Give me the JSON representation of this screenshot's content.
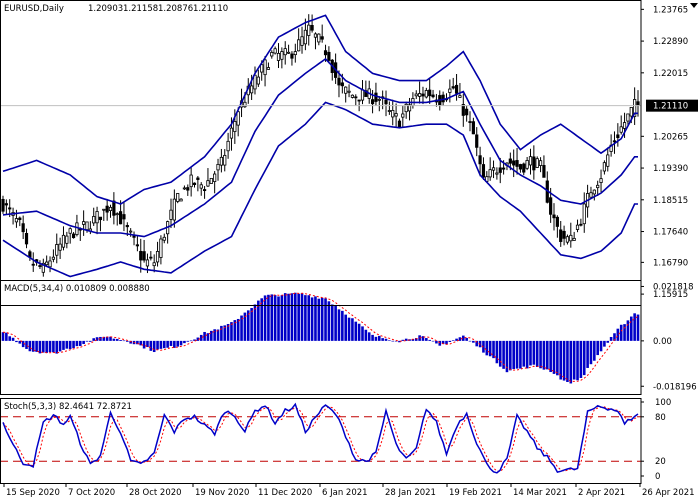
{
  "chart_data": {
    "type": "candlestick",
    "symbol_header": "EURUSD,Daily",
    "ohlc_header": [
      "1.20903",
      "1.21158",
      "1.20876",
      "1.21110"
    ],
    "current_price_label": "1.21110",
    "current_price": 1.2111,
    "colors": {
      "band": "#0000a8",
      "candle": "#000000",
      "macd_hist": "#0000c8",
      "macd_signal": "#ff0000",
      "stoch_main": "#0000c8",
      "stoch_signal": "#ff0000",
      "level_line": "#c00000",
      "current_line": "#c0c0c0",
      "price_box": "#000000",
      "price_box_text": "#ffffff"
    },
    "price_axis": {
      "ticks": [
        "1.23765",
        "1.22890",
        "1.22015",
        "1.21110",
        "1.20265",
        "1.19390",
        "1.18515",
        "1.17640",
        "1.16790",
        "1.15915"
      ],
      "min": 1.1567,
      "max": 1.2394
    },
    "x_axis": {
      "ticks": [
        "15 Sep 2020",
        "7 Oct 2020",
        "28 Oct 2020",
        "19 Nov 2020",
        "11 Dec 2020",
        "6 Jan 2021",
        "28 Jan 2021",
        "19 Feb 2021",
        "14 Mar 2021",
        "2 Apr 2021",
        "26 Apr 2021"
      ],
      "bar_count": 160
    },
    "price_anchors": [
      [
        0,
        1.184
      ],
      [
        5,
        1.178
      ],
      [
        8,
        1.168
      ],
      [
        12,
        1.166
      ],
      [
        15,
        1.17
      ],
      [
        20,
        1.176
      ],
      [
        25,
        1.178
      ],
      [
        30,
        1.182
      ],
      [
        32,
        1.184
      ],
      [
        35,
        1.18
      ],
      [
        38,
        1.175
      ],
      [
        42,
        1.168
      ],
      [
        45,
        1.168
      ],
      [
        48,
        1.176
      ],
      [
        52,
        1.186
      ],
      [
        56,
        1.19
      ],
      [
        60,
        1.189
      ],
      [
        65,
        1.195
      ],
      [
        70,
        1.21
      ],
      [
        75,
        1.218
      ],
      [
        80,
        1.225
      ],
      [
        85,
        1.225
      ],
      [
        88,
        1.228
      ],
      [
        91,
        1.232
      ],
      [
        94,
        1.229
      ],
      [
        97,
        1.225
      ],
      [
        100,
        1.216
      ],
      [
        104,
        1.214
      ],
      [
        108,
        1.214
      ],
      [
        112,
        1.213
      ],
      [
        115,
        1.209
      ],
      [
        118,
        1.207
      ],
      [
        122,
        1.213
      ],
      [
        126,
        1.215
      ],
      [
        130,
        1.213
      ],
      [
        134,
        1.216
      ],
      [
        137,
        1.21
      ],
      [
        140,
        1.203
      ],
      [
        143,
        1.19
      ],
      [
        146,
        1.193
      ],
      [
        150,
        1.196
      ],
      [
        154,
        1.194
      ],
      [
        157,
        1.196
      ],
      [
        160,
        1.194
      ],
      [
        163,
        1.182
      ],
      [
        166,
        1.175
      ],
      [
        169,
        1.174
      ],
      [
        172,
        1.18
      ],
      [
        175,
        1.188
      ],
      [
        178,
        1.192
      ],
      [
        181,
        1.2
      ],
      [
        184,
        1.205
      ],
      [
        188,
        1.2111
      ]
    ],
    "bollinger_bands": {
      "upper": [
        [
          0,
          1.193
        ],
        [
          10,
          1.196
        ],
        [
          20,
          1.192
        ],
        [
          28,
          1.186
        ],
        [
          35,
          1.184
        ],
        [
          42,
          1.188
        ],
        [
          50,
          1.19
        ],
        [
          60,
          1.197
        ],
        [
          68,
          1.206
        ],
        [
          75,
          1.22
        ],
        [
          82,
          1.23
        ],
        [
          90,
          1.234
        ],
        [
          96,
          1.236
        ],
        [
          102,
          1.226
        ],
        [
          110,
          1.22
        ],
        [
          118,
          1.218
        ],
        [
          126,
          1.218
        ],
        [
          132,
          1.222
        ],
        [
          137,
          1.226
        ],
        [
          142,
          1.218
        ],
        [
          148,
          1.206
        ],
        [
          154,
          1.199
        ],
        [
          160,
          1.203
        ],
        [
          166,
          1.206
        ],
        [
          172,
          1.202
        ],
        [
          178,
          1.198
        ],
        [
          184,
          1.202
        ],
        [
          188,
          1.209
        ]
      ],
      "middle": [
        [
          0,
          1.181
        ],
        [
          10,
          1.182
        ],
        [
          20,
          1.178
        ],
        [
          28,
          1.176
        ],
        [
          35,
          1.176
        ],
        [
          42,
          1.175
        ],
        [
          50,
          1.178
        ],
        [
          60,
          1.184
        ],
        [
          68,
          1.19
        ],
        [
          75,
          1.204
        ],
        [
          82,
          1.214
        ],
        [
          90,
          1.22
        ],
        [
          96,
          1.224
        ],
        [
          102,
          1.218
        ],
        [
          110,
          1.214
        ],
        [
          118,
          1.212
        ],
        [
          126,
          1.212
        ],
        [
          132,
          1.213
        ],
        [
          137,
          1.215
        ],
        [
          142,
          1.206
        ],
        [
          148,
          1.196
        ],
        [
          154,
          1.192
        ],
        [
          160,
          1.189
        ],
        [
          166,
          1.185
        ],
        [
          172,
          1.184
        ],
        [
          178,
          1.187
        ],
        [
          184,
          1.192
        ],
        [
          188,
          1.197
        ]
      ],
      "lower": [
        [
          0,
          1.174
        ],
        [
          10,
          1.168
        ],
        [
          20,
          1.164
        ],
        [
          28,
          1.166
        ],
        [
          35,
          1.168
        ],
        [
          42,
          1.166
        ],
        [
          50,
          1.165
        ],
        [
          60,
          1.171
        ],
        [
          68,
          1.175
        ],
        [
          75,
          1.188
        ],
        [
          82,
          1.2
        ],
        [
          90,
          1.206
        ],
        [
          96,
          1.212
        ],
        [
          102,
          1.21
        ],
        [
          110,
          1.206
        ],
        [
          118,
          1.205
        ],
        [
          126,
          1.206
        ],
        [
          132,
          1.206
        ],
        [
          137,
          1.203
        ],
        [
          142,
          1.192
        ],
        [
          148,
          1.186
        ],
        [
          154,
          1.182
        ],
        [
          160,
          1.176
        ],
        [
          166,
          1.17
        ],
        [
          172,
          1.169
        ],
        [
          178,
          1.171
        ],
        [
          184,
          1.176
        ],
        [
          188,
          1.184
        ]
      ]
    },
    "macd": {
      "header": "MACD(5,34,4) 0.010809 0.008880",
      "axis_ticks": [
        "0.021818",
        "0.00",
        "-0.018196"
      ],
      "min": -0.0205,
      "max": 0.0232,
      "anchors": [
        [
          0,
          0.004
        ],
        [
          8,
          -0.004
        ],
        [
          15,
          -0.005
        ],
        [
          22,
          -0.002
        ],
        [
          30,
          0.002
        ],
        [
          37,
          0.0
        ],
        [
          45,
          -0.004
        ],
        [
          52,
          -0.002
        ],
        [
          60,
          0.003
        ],
        [
          68,
          0.007
        ],
        [
          78,
          0.018
        ],
        [
          88,
          0.019
        ],
        [
          96,
          0.017
        ],
        [
          102,
          0.011
        ],
        [
          110,
          0.002
        ],
        [
          118,
          0.0
        ],
        [
          124,
          0.002
        ],
        [
          130,
          -0.002
        ],
        [
          137,
          0.002
        ],
        [
          142,
          -0.003
        ],
        [
          150,
          -0.012
        ],
        [
          158,
          -0.01
        ],
        [
          163,
          -0.012
        ],
        [
          168,
          -0.017
        ],
        [
          172,
          -0.015
        ],
        [
          178,
          -0.004
        ],
        [
          184,
          0.006
        ],
        [
          188,
          0.011
        ]
      ]
    },
    "stochastic": {
      "header": "Stoch(5,3,3) 82.4641 72.8721",
      "axis_ticks": [
        "100",
        "80",
        "20",
        "0"
      ],
      "levels": [
        80,
        20
      ],
      "anchors": [
        [
          0,
          72
        ],
        [
          3,
          42
        ],
        [
          6,
          18
        ],
        [
          9,
          15
        ],
        [
          12,
          72
        ],
        [
          15,
          82
        ],
        [
          18,
          70
        ],
        [
          20,
          80
        ],
        [
          23,
          45
        ],
        [
          26,
          15
        ],
        [
          29,
          28
        ],
        [
          32,
          85
        ],
        [
          35,
          60
        ],
        [
          38,
          20
        ],
        [
          41,
          15
        ],
        [
          45,
          30
        ],
        [
          48,
          82
        ],
        [
          51,
          60
        ],
        [
          54,
          78
        ],
        [
          57,
          80
        ],
        [
          60,
          68
        ],
        [
          63,
          58
        ],
        [
          66,
          88
        ],
        [
          69,
          82
        ],
        [
          72,
          60
        ],
        [
          75,
          88
        ],
        [
          78,
          96
        ],
        [
          81,
          72
        ],
        [
          84,
          88
        ],
        [
          87,
          95
        ],
        [
          90,
          60
        ],
        [
          93,
          80
        ],
        [
          96,
          95
        ],
        [
          99,
          84
        ],
        [
          102,
          55
        ],
        [
          105,
          22
        ],
        [
          108,
          20
        ],
        [
          111,
          30
        ],
        [
          114,
          88
        ],
        [
          117,
          42
        ],
        [
          120,
          22
        ],
        [
          123,
          36
        ],
        [
          126,
          92
        ],
        [
          129,
          72
        ],
        [
          132,
          30
        ],
        [
          135,
          68
        ],
        [
          138,
          85
        ],
        [
          141,
          45
        ],
        [
          144,
          15
        ],
        [
          147,
          5
        ],
        [
          150,
          22
        ],
        [
          153,
          80
        ],
        [
          156,
          60
        ],
        [
          159,
          38
        ],
        [
          162,
          25
        ],
        [
          165,
          8
        ],
        [
          168,
          8
        ],
        [
          171,
          10
        ],
        [
          174,
          85
        ],
        [
          177,
          95
        ],
        [
          180,
          92
        ],
        [
          183,
          88
        ],
        [
          185,
          70
        ],
        [
          188,
          82
        ]
      ]
    }
  }
}
